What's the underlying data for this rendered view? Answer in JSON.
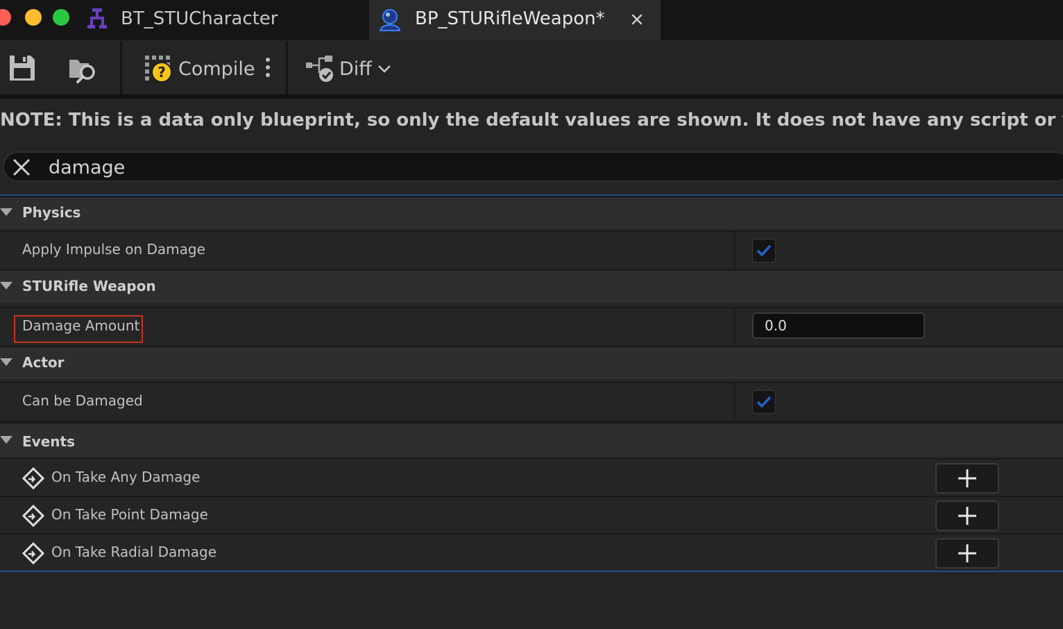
{
  "tabs": [
    {
      "label": "BT_STUCharacter",
      "icon": "behavior-tree-icon",
      "active": false
    },
    {
      "label": "BP_STURifleWeapon*",
      "icon": "blueprint-actor-icon",
      "active": true
    }
  ],
  "toolbar": {
    "save_icon": "save-icon",
    "browse_icon": "browse-to-asset-icon",
    "compile_label": "Compile",
    "compile_icon": "compile-status-unknown-icon",
    "diff_label": "Diff"
  },
  "note": "NOTE: This is a data only blueprint, so only the default values are shown.  It does not have any script or variables.  If you want t",
  "search": {
    "value": "damage"
  },
  "categories": [
    {
      "name": "Physics",
      "properties": [
        {
          "label": "Apply Impulse on Damage",
          "type": "checkbox",
          "checked": true
        }
      ]
    },
    {
      "name": "STURifle Weapon",
      "properties": [
        {
          "label": "Damage Amount",
          "type": "number",
          "value": "0.0",
          "highlighted": true
        }
      ]
    },
    {
      "name": "Actor",
      "properties": [
        {
          "label": "Can be Damaged",
          "type": "checkbox",
          "checked": true
        }
      ]
    },
    {
      "name": "Events",
      "properties": [
        {
          "label": "On Take Any Damage",
          "type": "event"
        },
        {
          "label": "On Take Point Damage",
          "type": "event"
        },
        {
          "label": "On Take Radial Damage",
          "type": "event"
        }
      ]
    }
  ],
  "colors": {
    "accent": "#2563c9",
    "highlight": "#c8321e",
    "traffic_red": "#ff5f57",
    "traffic_yellow": "#febc2e",
    "traffic_green": "#28c840"
  }
}
